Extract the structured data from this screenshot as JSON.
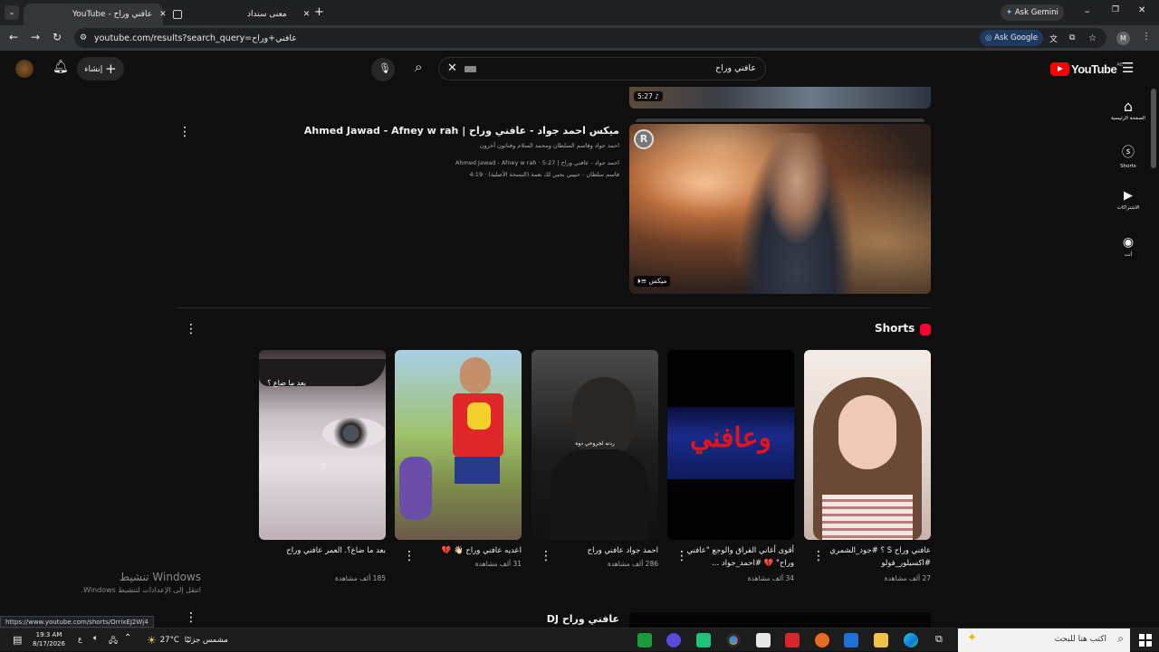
{
  "browser": {
    "tabs": [
      {
        "title": "YouTube - عافني وراح"
      },
      {
        "title": "معنى سنداد"
      }
    ],
    "ask_gemini": "Ask Gemini",
    "address": "youtube.com/results?search_query=عافني+وراح",
    "ask_google": "Ask Google",
    "profile_initial": "M",
    "status_url": "https://www.youtube.com/shorts/OrrixEJ2Wj4"
  },
  "youtube": {
    "logo_text": "YouTube",
    "region": "AE",
    "search_query": "عافني وراح",
    "create_label": "إنشاء",
    "sidebar": [
      {
        "label": "الصفحة الرئيسية",
        "icon": "home-icon"
      },
      {
        "label": "Shorts",
        "icon": "shorts-icon"
      },
      {
        "label": "الاشتراكات",
        "icon": "subscriptions-icon"
      },
      {
        "label": "أنت",
        "icon": "you-icon"
      }
    ],
    "top_thumb_duration": "5:27",
    "mix": {
      "title": "ميكس احمد جواد - عافني وراح | Ahmed Jawad - Afney w rah",
      "artists": "احمد جواد وقاسم السلطان ومحمد السلام وفنانون آخرون",
      "line1": "احمد جواد - عافني وراح | Ahmed Jawad - Afney w rah · 5:27",
      "line2": "قاسم سلطان - حبيبي بجبي لك نعمة (النسخة الأصلية) · 4:19",
      "badge": "ميكس",
      "thumb_letter": "R"
    },
    "shorts": {
      "heading": "Shorts",
      "items": [
        {
          "title": "عافني وراح S ؟ #جود_الشمري #اكسبلور_فولو",
          "views": "27 ألف مشاهدة",
          "overlay": ""
        },
        {
          "title": "أقوى أغاني الفراق والوجع \"عافني وراح\" 💔 #احمد_جواد ...",
          "views": "34 ألف مشاهدة",
          "overlay": "وعافني"
        },
        {
          "title": "احمد جواد عافني وراح",
          "views": "286 ألف مشاهدة",
          "overlay": "ردته لجروحي دوه"
        },
        {
          "title": "اعديه عافني وراح 👋🏻 💔",
          "views": "31 ألف مشاهدة",
          "overlay": ""
        },
        {
          "title": "بعد ما ضاع؟. العمر عافني وراح",
          "views": "185 ألف مشاهدة",
          "overlay": "بعد ما ضاع ؟"
        }
      ]
    },
    "next_title": "عافني وراح DJ"
  },
  "windows_watermark": {
    "title": "تنشيط Windows",
    "subtitle": "انتقل إلى الإعدادات لتنشيط Windows."
  },
  "taskbar": {
    "search_placeholder": "اكتب هنا للبحث",
    "weather_temp": "27°C",
    "weather_text": "مشمس جزئيًا",
    "time": "19:3 AM",
    "date": "8/17/2026",
    "lang": "ع"
  }
}
